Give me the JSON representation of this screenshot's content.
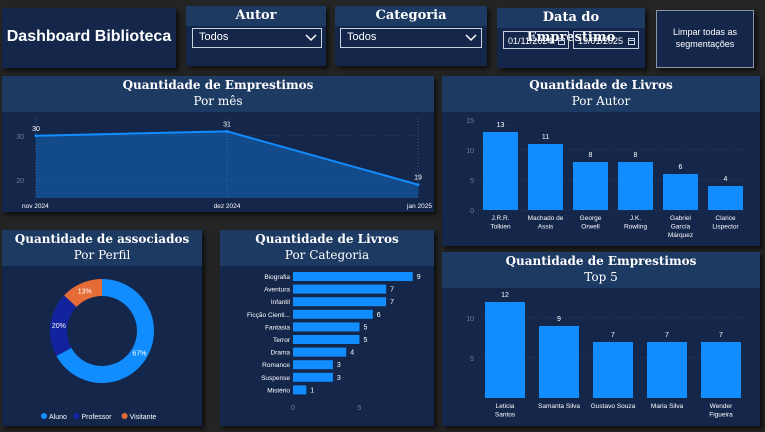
{
  "header": {
    "title": "Dashboard Biblioteca"
  },
  "slicers": {
    "autor": {
      "title": "Autor",
      "value": "Todos"
    },
    "categoria": {
      "title": "Categoria",
      "value": "Todos"
    },
    "data": {
      "title": "Data do Emprestimo",
      "start": "01/11/2024",
      "end": "19/01/2025"
    },
    "clear_button": "Limpar todas as segmentações"
  },
  "panels": {
    "emprestimos_mes": {
      "title": "Quantidade de Emprestimos",
      "subtitle": "Por mês"
    },
    "livros_autor": {
      "title": "Quantidade de Livros",
      "subtitle": "Por Autor"
    },
    "associados": {
      "title": "Quantidade de associados",
      "subtitle": "Por Perfil"
    },
    "livros_categoria": {
      "title": "Quantidade de Livros",
      "subtitle": "Por Categoria"
    },
    "emprestimos_top5": {
      "title": "Quantidade de Emprestimos",
      "subtitle": "Top 5"
    }
  },
  "colors": {
    "bar": "#118dff",
    "bg": "#14274b",
    "header": "#1d3a63",
    "professor": "#12239e",
    "visitante": "#e66c37"
  },
  "chart_data": [
    {
      "id": "emprestimos_mes",
      "type": "area",
      "categories": [
        "nov 2024",
        "dez 2024",
        "jan 2025"
      ],
      "values": [
        30,
        31,
        19
      ],
      "yticks": [
        20,
        30
      ],
      "ylim": [
        16,
        34
      ]
    },
    {
      "id": "livros_autor",
      "type": "bar",
      "categories": [
        "J.R.R. Tolkien",
        "Machado de Assis",
        "George Orwell",
        "J.K. Rowling",
        "Gabriel García Márquez",
        "Clarice Lispector"
      ],
      "values": [
        13,
        11,
        8,
        8,
        6,
        4
      ],
      "yticks": [
        0,
        5,
        10,
        15
      ],
      "ylim": [
        0,
        15
      ]
    },
    {
      "id": "associados",
      "type": "pie",
      "categories": [
        "Aluno",
        "Professor",
        "Visitante"
      ],
      "values": [
        67,
        20,
        13
      ],
      "labels": [
        "67%",
        "20%",
        "13%"
      ]
    },
    {
      "id": "livros_categoria",
      "type": "bar",
      "categories": [
        "Biografia",
        "Aventura",
        "Infantil",
        "Ficção Cienti...",
        "Fantasia",
        "Terror",
        "Drama",
        "Romance",
        "Suspense",
        "Mistério"
      ],
      "values": [
        9,
        7,
        7,
        6,
        5,
        5,
        4,
        3,
        3,
        1
      ],
      "xticks": [
        0,
        5
      ],
      "xlim": [
        0,
        9.7
      ]
    },
    {
      "id": "emprestimos_top5",
      "type": "bar",
      "categories": [
        "Leticia Santos",
        "Samanta Silva",
        "Gustavo Souza",
        "Maria Silva",
        "Wender Figueira"
      ],
      "values": [
        12,
        9,
        7,
        7,
        7
      ],
      "yticks": [
        5,
        10
      ],
      "ylim": [
        0,
        13
      ]
    }
  ]
}
